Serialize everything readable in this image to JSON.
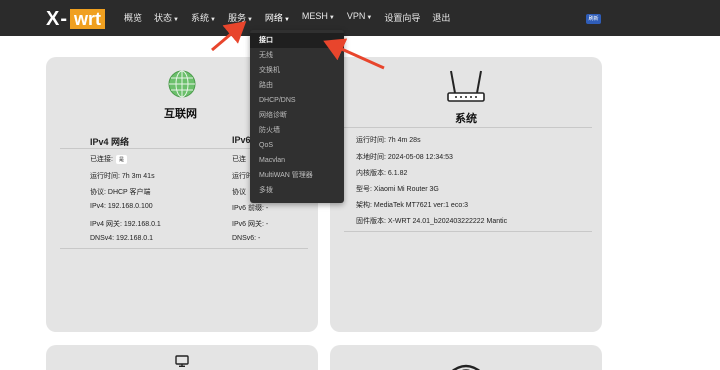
{
  "brand": {
    "logo_left": "X-",
    "logo_right": "wrt"
  },
  "nav": {
    "items": [
      {
        "label": "概览",
        "caret": false
      },
      {
        "label": "状态",
        "caret": true
      },
      {
        "label": "系统",
        "caret": true
      },
      {
        "label": "服务",
        "caret": true
      },
      {
        "label": "网络",
        "caret": true
      },
      {
        "label": "MESH",
        "caret": true
      },
      {
        "label": "VPN",
        "caret": true
      },
      {
        "label": "设置向导",
        "caret": false
      },
      {
        "label": "退出",
        "caret": false
      }
    ],
    "refresh_badge": "刷新"
  },
  "network_menu": {
    "items": [
      "接口",
      "无线",
      "交换机",
      "路由",
      "DHCP/DNS",
      "网络诊断",
      "防火墙",
      "QoS",
      "Macvlan",
      "MultiWAN 管理器",
      "多拨"
    ],
    "active_index": 0
  },
  "internet_card": {
    "title": "互联网",
    "ipv4": {
      "heading": "IPv4 网络",
      "connected_label": "已连接:",
      "connected_value": "是",
      "uptime": "运行时间: 7h 3m 41s",
      "protocol": "协议: DHCP 客户端",
      "ipv4": "IPv4: 192.168.0.100",
      "gateway": "IPv4 网关: 192.168.0.1",
      "dns": "DNSv4: 192.168.0.1"
    },
    "ipv6": {
      "heading": "IPv6",
      "connected_label": "已连",
      "uptime": "运行时",
      "protocol": "协议",
      "ipv6": "IPv6 前缀: -",
      "gateway": "IPv6 网关: -",
      "dns": "DNSv6: -"
    }
  },
  "system_card": {
    "title": "系统",
    "uptime": "运行时间: 7h 4m 28s",
    "local_time": "本地时间: 2024-05-08 12:34:53",
    "kernel": "内核版本: 6.1.82",
    "model": "型号: Xiaomi Mi Router 3G",
    "arch": "架构: MediaTek MT7621 ver:1 eco:3",
    "firmware": "固件版本: X-WRT 24.01_b202403222222 Mantic"
  },
  "colors": {
    "topbar": "#2b2b2b",
    "logo_accent": "#f0a020",
    "card_bg": "#e4e4e4",
    "dropdown_bg": "#303030",
    "arrow": "#e8452c",
    "badge": "#2f5db8",
    "globe": "#5cb85c"
  },
  "icons": [
    "globe-icon",
    "router-icon",
    "monitor-icon",
    "wifi-icon",
    "caret-down-icon"
  ]
}
